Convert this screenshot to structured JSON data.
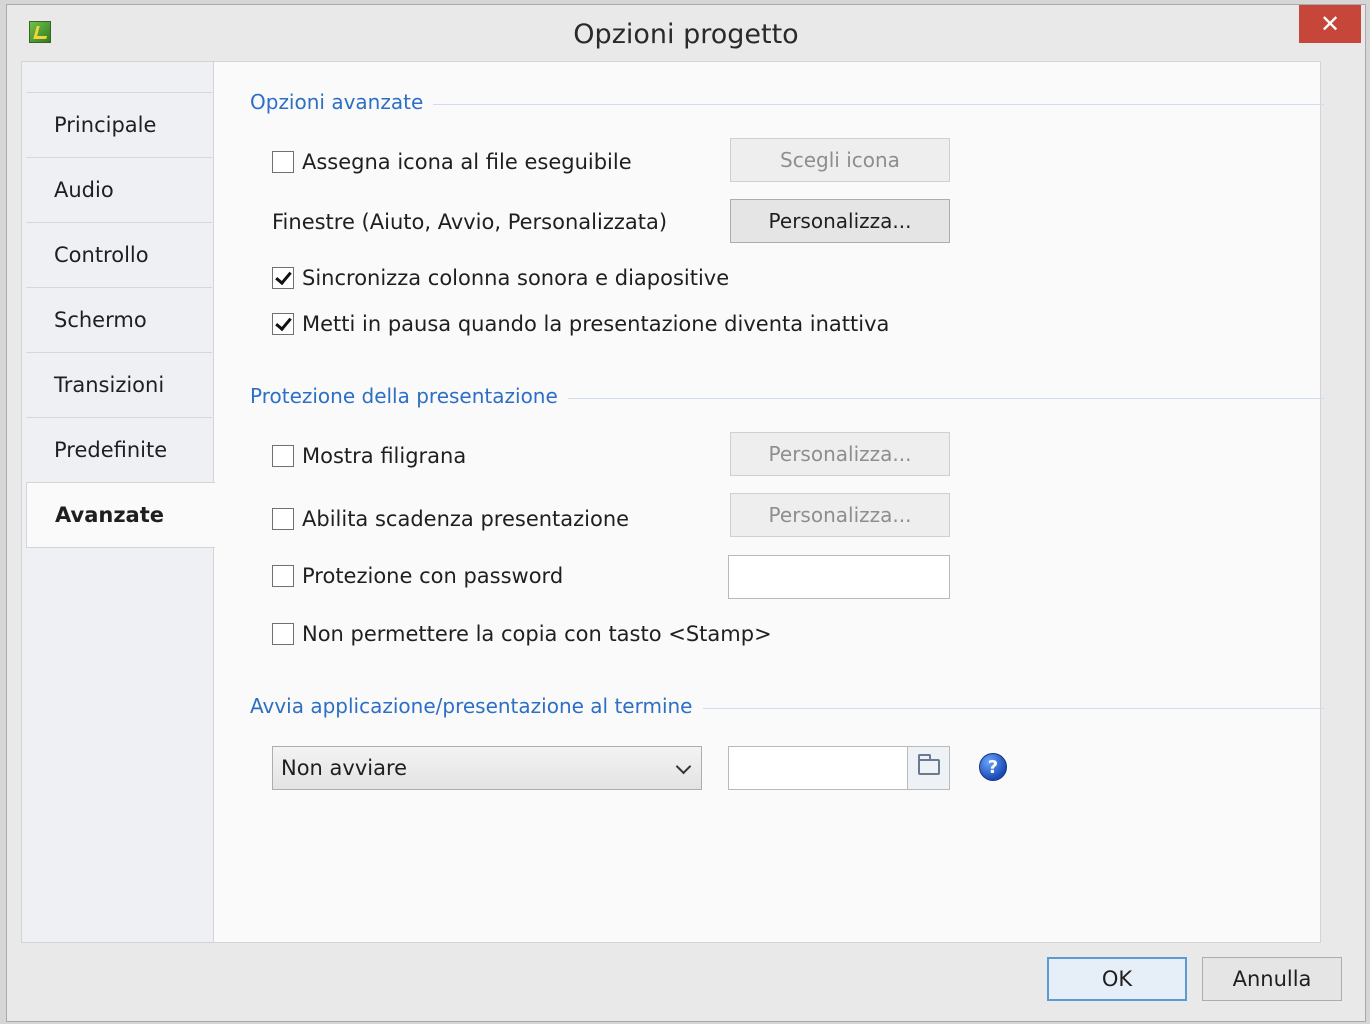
{
  "window": {
    "title": "Opzioni progetto",
    "close_glyph": "✕"
  },
  "sidebar": {
    "items": [
      {
        "label": "Principale"
      },
      {
        "label": "Audio"
      },
      {
        "label": "Controllo"
      },
      {
        "label": "Schermo"
      },
      {
        "label": "Transizioni"
      },
      {
        "label": "Predefinite"
      },
      {
        "label": "Avanzate",
        "active": true
      }
    ]
  },
  "advanced": {
    "title": "Opzioni avanzate",
    "assign_icon": {
      "label": "Assegna icona al file eseguibile",
      "checked": false
    },
    "choose_icon_button": "Scegli icona",
    "windows_label": "Finestre (Aiuto, Avvio, Personalizzata)",
    "customize_windows_button": "Personalizza...",
    "sync_soundtrack": {
      "label": "Sincronizza colonna sonora e diapositive",
      "checked": true
    },
    "pause_inactive": {
      "label": "Metti in pausa quando la presentazione diventa inattiva",
      "checked": true
    }
  },
  "protection": {
    "title": "Protezione della presentazione",
    "watermark": {
      "label": "Mostra filigrana",
      "checked": false
    },
    "watermark_button": "Personalizza...",
    "expiry": {
      "label": "Abilita scadenza presentazione",
      "checked": false
    },
    "expiry_button": "Personalizza...",
    "password": {
      "label": "Protezione con password",
      "checked": false,
      "value": ""
    },
    "no_print_screen": {
      "label": "Non permettere la copia con tasto <Stamp>",
      "checked": false
    }
  },
  "launch": {
    "title": "Avvia applicazione/presentazione al termine",
    "selected": "Non avviare",
    "path_value": "",
    "help_glyph": "?"
  },
  "footer": {
    "ok": "OK",
    "cancel": "Annulla"
  },
  "colors": {
    "accent": "#2c6fc4",
    "close": "#c7463a"
  }
}
